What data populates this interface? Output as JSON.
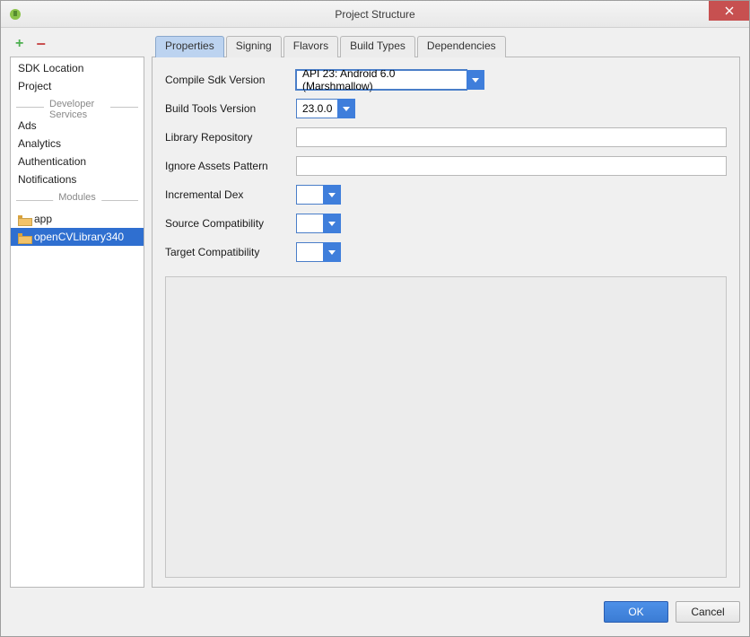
{
  "window": {
    "title": "Project Structure"
  },
  "sidebar": {
    "items_top": [
      "SDK Location",
      "Project"
    ],
    "section_dev": "Developer Services",
    "items_dev": [
      "Ads",
      "Analytics",
      "Authentication",
      "Notifications"
    ],
    "section_mod": "Modules",
    "modules": [
      "app",
      "openCVLibrary340"
    ],
    "selected_module_index": 1
  },
  "tabs": {
    "items": [
      "Properties",
      "Signing",
      "Flavors",
      "Build Types",
      "Dependencies"
    ],
    "active_index": 0
  },
  "form": {
    "compile_sdk_label": "Compile Sdk Version",
    "compile_sdk_value": "API 23: Android 6.0 (Marshmallow)",
    "build_tools_label": "Build Tools Version",
    "build_tools_value": "23.0.0",
    "library_repo_label": "Library Repository",
    "library_repo_value": "",
    "ignore_assets_label": "Ignore Assets Pattern",
    "ignore_assets_value": "",
    "incremental_dex_label": "Incremental Dex",
    "incremental_dex_value": "",
    "source_compat_label": "Source Compatibility",
    "source_compat_value": "",
    "target_compat_label": "Target Compatibility",
    "target_compat_value": ""
  },
  "footer": {
    "ok": "OK",
    "cancel": "Cancel"
  }
}
